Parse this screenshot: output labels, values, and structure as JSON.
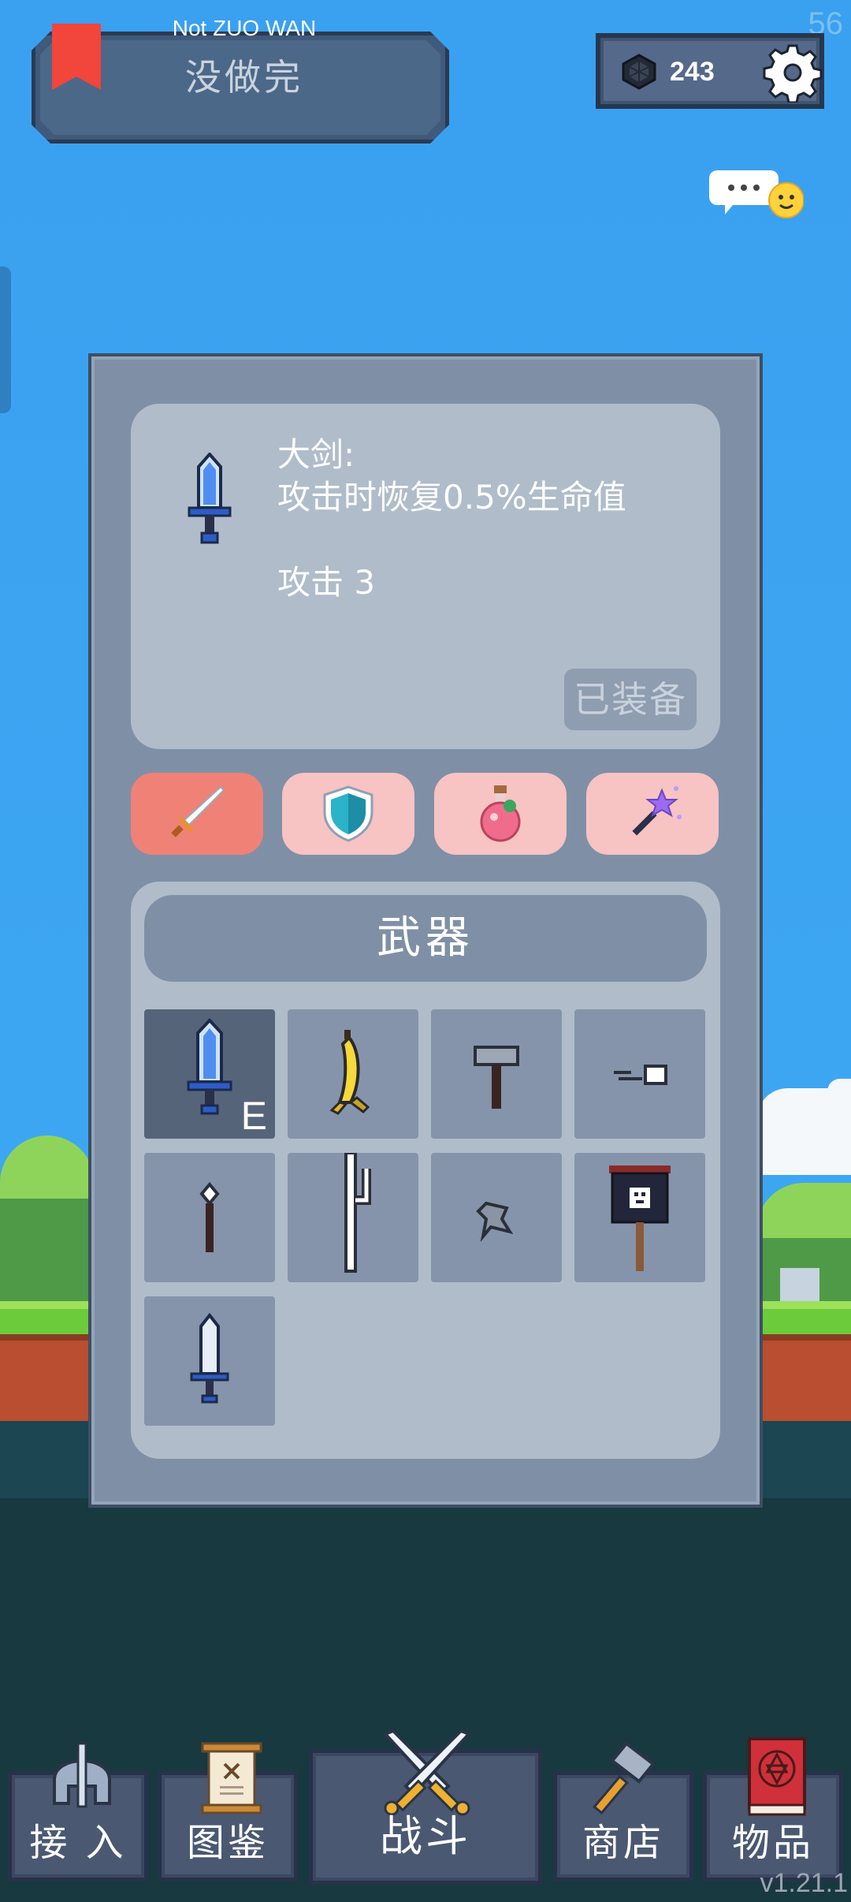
{
  "hud": {
    "fps": "56",
    "version": "v1.21.1",
    "title_en": "Not ZUO WAN",
    "title_cn": "没做完",
    "coins": "243"
  },
  "detail": {
    "description": "大剑:\n攻击时恢复0.5%生命值\n\n攻击 3",
    "equipped_label": "已装备"
  },
  "category_tabs": [
    {
      "icon": "sword-icon",
      "active": true,
      "color": "#f08176"
    },
    {
      "icon": "shield-icon",
      "active": false,
      "color": "#f7c3c3"
    },
    {
      "icon": "potion-icon",
      "active": false,
      "color": "#f7c3c3"
    },
    {
      "icon": "magic-wand-icon",
      "active": false,
      "color": "#f7c3c3"
    }
  ],
  "inventory": {
    "title": "武器",
    "equipped_marker": "E",
    "items": [
      {
        "icon": "blue-great-sword-icon",
        "equipped": true
      },
      {
        "icon": "banana-icon",
        "equipped": false
      },
      {
        "icon": "hammer-icon",
        "equipped": false
      },
      {
        "icon": "bullet-icon",
        "equipped": false
      },
      {
        "icon": "spear-icon",
        "equipped": false
      },
      {
        "icon": "cane-icon",
        "equipped": false
      },
      {
        "icon": "shuriken-icon",
        "equipped": false
      },
      {
        "icon": "banner-icon",
        "equipped": false
      },
      {
        "icon": "short-sword-icon",
        "equipped": false
      }
    ]
  },
  "bottom_nav": [
    {
      "label": "接 入",
      "icon": "helmet-icon"
    },
    {
      "label": "图鉴",
      "icon": "scroll-icon"
    },
    {
      "label": "战斗",
      "icon": "crossed-swords-icon"
    },
    {
      "label": "商店",
      "icon": "hammer-icon"
    },
    {
      "label": "物品",
      "icon": "spellbook-icon"
    }
  ],
  "colors": {
    "sky": "#3da6f2",
    "panel": "#7f90a6",
    "card": "#b0bcca",
    "selected_slot": "#566479",
    "slot": "#8594aa",
    "active_tab": "#f08176",
    "inactive_tab": "#f7c3c3"
  }
}
